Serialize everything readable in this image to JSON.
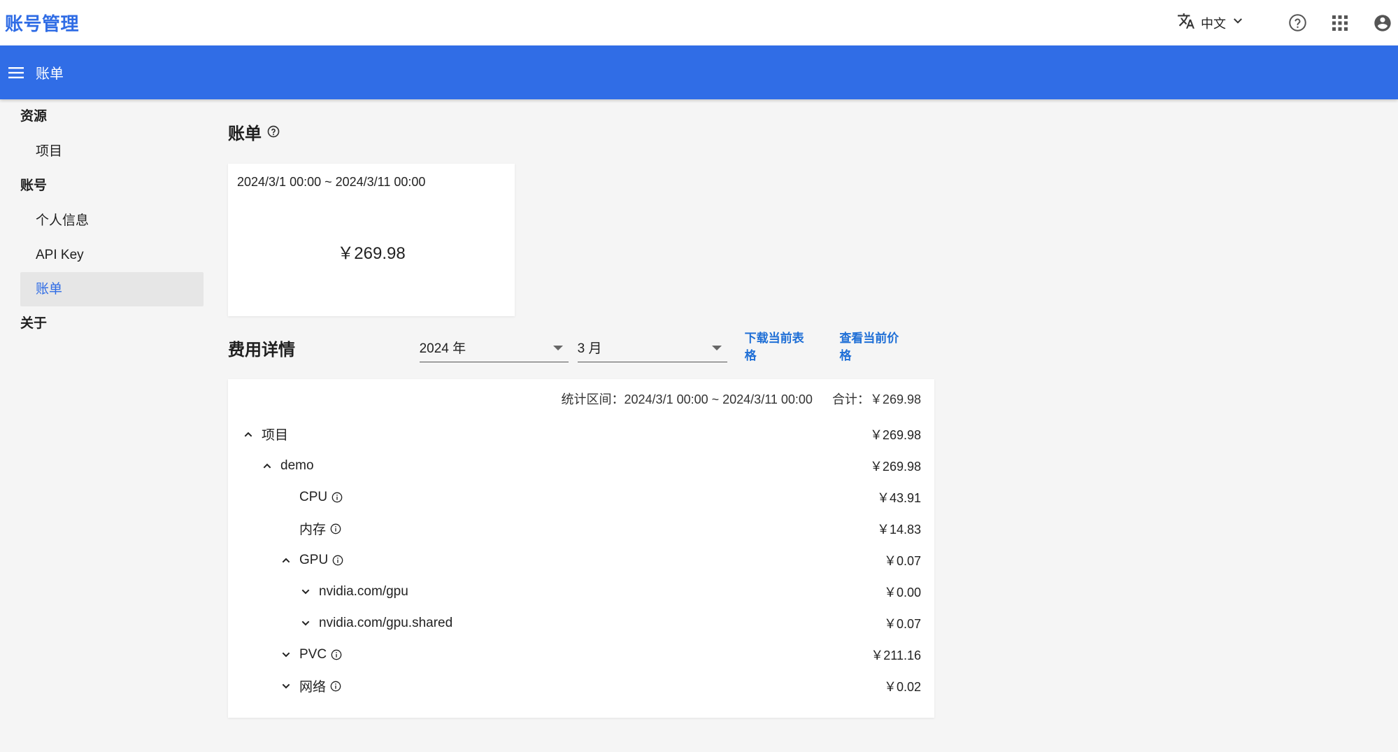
{
  "app": {
    "title": "账号管理"
  },
  "topbar": {
    "language": "中文"
  },
  "header": {
    "title": "账单"
  },
  "sidebar": {
    "groups": [
      {
        "label": "资源",
        "items": [
          {
            "label": "项目"
          }
        ]
      },
      {
        "label": "账号",
        "items": [
          {
            "label": "个人信息"
          },
          {
            "label": "API Key"
          },
          {
            "label": "账单"
          }
        ]
      },
      {
        "label": "关于",
        "items": []
      }
    ]
  },
  "bill": {
    "title": "账单",
    "range": "2024/3/1 00:00 ~ 2024/3/11 00:00",
    "total": "￥269.98"
  },
  "details": {
    "title": "费用详情",
    "year": "2024 年",
    "month": "3 月",
    "download_label": "下载当前表格",
    "price_label": "查看当前价格",
    "stats_range": "统计区间：2024/3/1 00:00 ~ 2024/3/11 00:00",
    "stats_total": "合计：￥269.98",
    "rows": [
      {
        "label": "项目",
        "amount": "￥269.98"
      },
      {
        "label": "demo",
        "amount": "￥269.98"
      },
      {
        "label": "CPU",
        "amount": "￥43.91"
      },
      {
        "label": "内存",
        "amount": "￥14.83"
      },
      {
        "label": "GPU",
        "amount": "￥0.07"
      },
      {
        "label": "nvidia.com/gpu",
        "amount": "￥0.00"
      },
      {
        "label": "nvidia.com/gpu.shared",
        "amount": "￥0.07"
      },
      {
        "label": "PVC",
        "amount": "￥211.16"
      },
      {
        "label": "网络",
        "amount": "￥0.02"
      }
    ]
  },
  "colors": {
    "brand": "#306de6",
    "link": "#1f6fd6",
    "active_nav_bg": "#e6e6e6"
  }
}
